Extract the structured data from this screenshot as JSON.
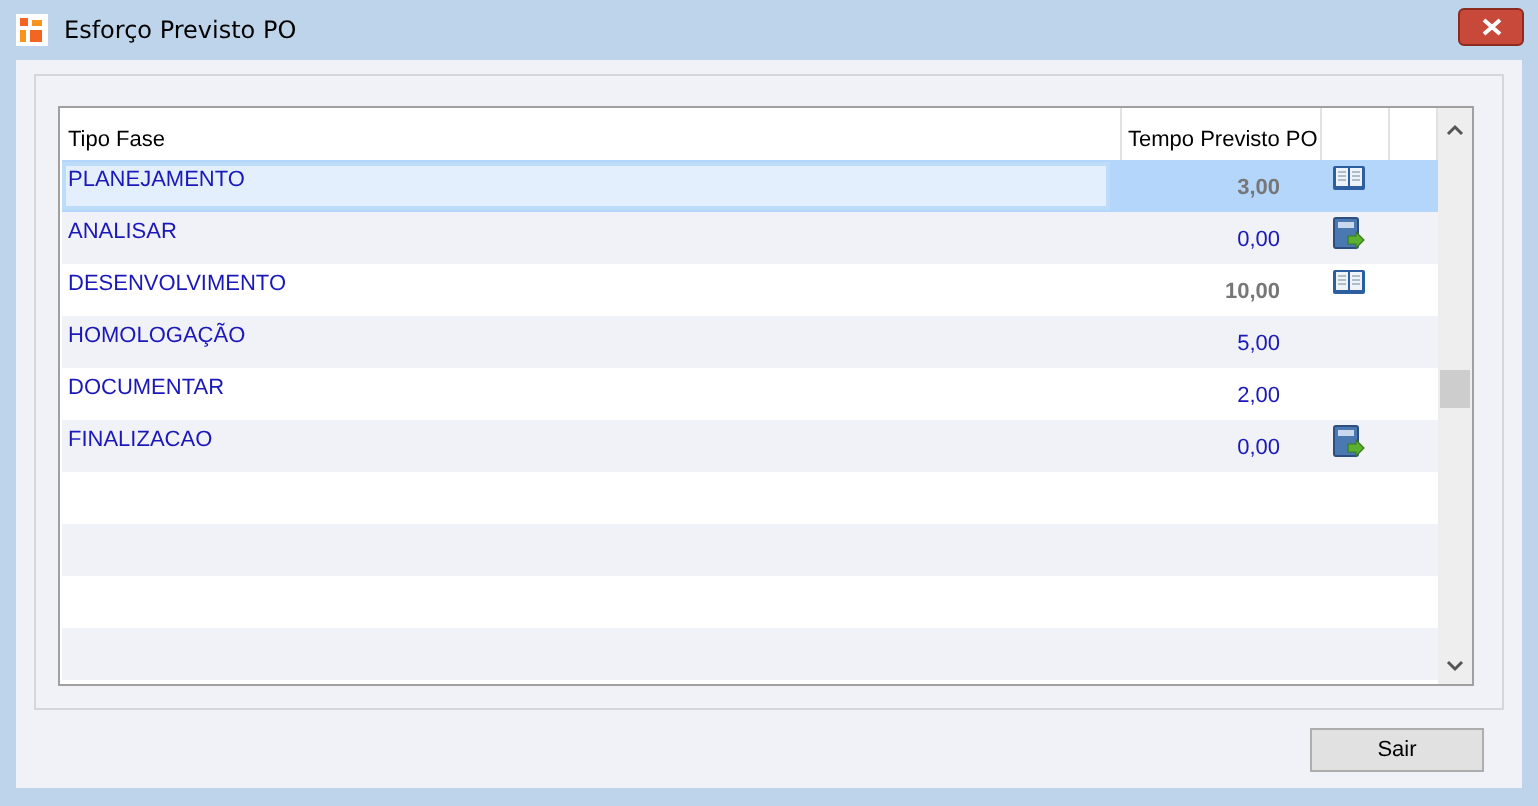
{
  "window": {
    "title": "Esforço Previsto PO"
  },
  "table": {
    "columns": [
      "Tipo Fase",
      "Tempo Previsto PO"
    ],
    "rows": [
      {
        "fase": "PLANEJAMENTO",
        "tempo": "3,00",
        "emphasis": true,
        "kind": "book",
        "selected": true
      },
      {
        "fase": "ANALISAR",
        "tempo": "0,00",
        "emphasis": false,
        "kind": "export",
        "selected": false
      },
      {
        "fase": "DESENVOLVIMENTO",
        "tempo": "10,00",
        "emphasis": true,
        "kind": "book",
        "selected": false
      },
      {
        "fase": "HOMOLOGAÇÃO",
        "tempo": "5,00",
        "emphasis": false,
        "kind": "plain",
        "selected": false
      },
      {
        "fase": "DOCUMENTAR",
        "tempo": "2,00",
        "emphasis": false,
        "kind": "plain",
        "selected": false
      },
      {
        "fase": "FINALIZACAO",
        "tempo": "0,00",
        "emphasis": false,
        "kind": "export",
        "selected": false
      }
    ]
  },
  "buttons": [
    "Sair"
  ]
}
